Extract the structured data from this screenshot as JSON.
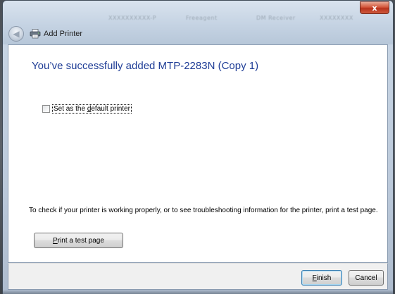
{
  "window": {
    "title": "Add Printer",
    "close_symbol": "x"
  },
  "background_taskbar": {
    "items": [
      "XXXXXXXXXX-P",
      "Freeagent",
      "DM Receiver",
      "XXXXXXXX"
    ]
  },
  "nav": {
    "back_symbol": "◀",
    "back_icon": "back-arrow-icon",
    "printer_icon": "printer-icon"
  },
  "main": {
    "heading": "You’ve successfully added MTP-2283N (Copy 1)",
    "default_checkbox": {
      "label_pre": "Set as the ",
      "label_mnemonic": "d",
      "label_post": "efault printer",
      "checked": false
    },
    "info_text": "To check if your printer is working properly, or to see troubleshooting information for the printer, print a test page.",
    "test_button": {
      "mnemonic": "P",
      "label_rest": "rint a test page"
    }
  },
  "footer": {
    "finish_button": {
      "mnemonic": "F",
      "label_rest": "inish"
    },
    "cancel_button": {
      "label": "Cancel"
    }
  },
  "colors": {
    "heading": "#1f3d96",
    "close_button": "#c8452b",
    "default_button_border": "#3c7fb1"
  }
}
